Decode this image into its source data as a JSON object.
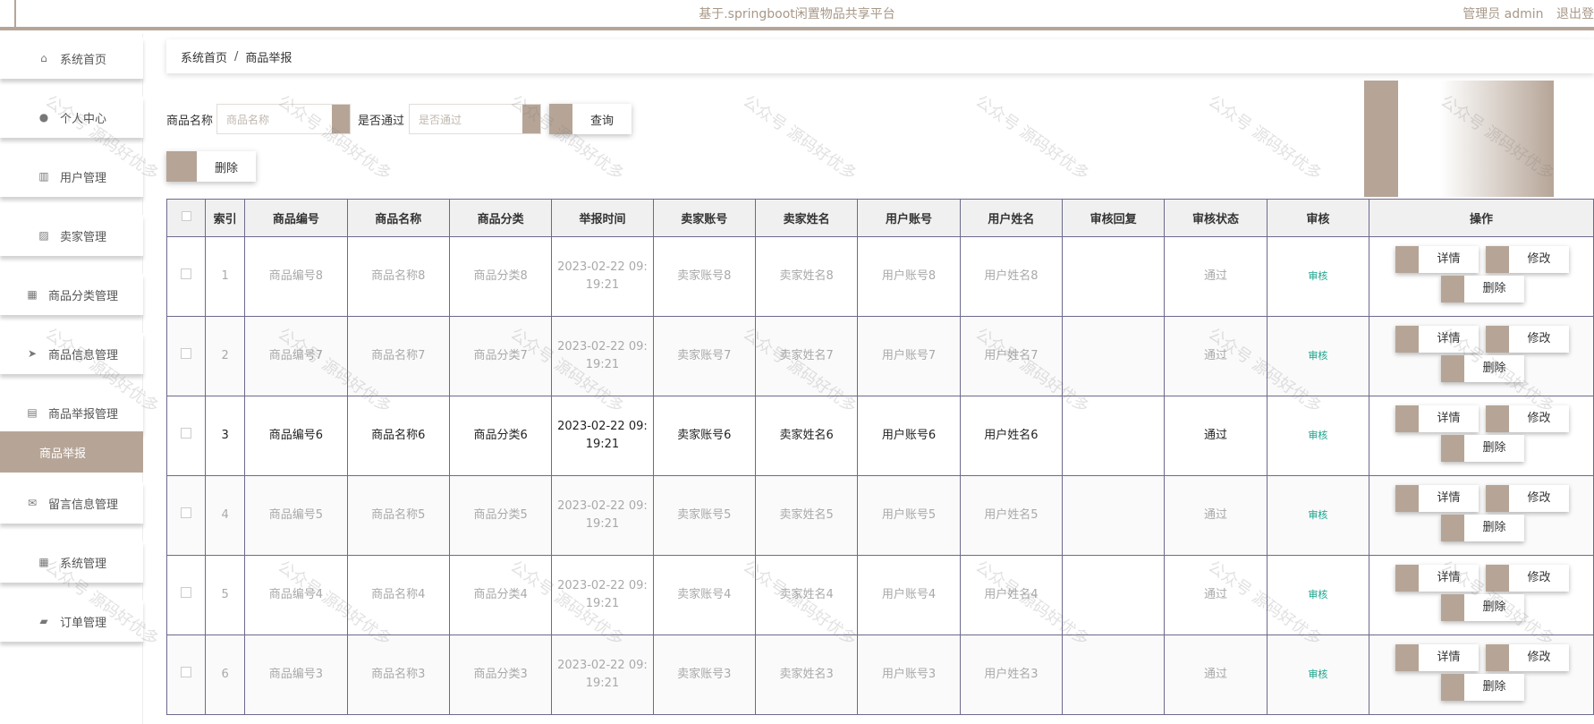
{
  "header": {
    "title": "基于.springboot闲置物品共享平台",
    "user_label": "管理员 admin",
    "logout": "退出登"
  },
  "sidebar": {
    "items": [
      {
        "label": "系统首页",
        "icon": "home-icon",
        "glyph": "⌂"
      },
      {
        "label": "个人中心",
        "icon": "user-icon",
        "glyph": "●"
      },
      {
        "label": "用户管理",
        "icon": "books-icon",
        "glyph": "▥"
      },
      {
        "label": "卖家管理",
        "icon": "chart-icon",
        "glyph": "▨"
      },
      {
        "label": "商品分类管理",
        "icon": "grid-icon",
        "glyph": "▦"
      },
      {
        "label": "商品信息管理",
        "icon": "send-icon",
        "glyph": "➤"
      },
      {
        "label": "商品举报管理",
        "icon": "clipboard-icon",
        "glyph": "▤"
      },
      {
        "label": "留言信息管理",
        "icon": "ticket-icon",
        "glyph": "✉"
      },
      {
        "label": "系统管理",
        "icon": "grid-icon",
        "glyph": "▦"
      },
      {
        "label": "订单管理",
        "icon": "folder-icon",
        "glyph": "▰"
      }
    ],
    "active_sub": "商品举报"
  },
  "breadcrumb": {
    "home": "系统首页",
    "sep": "/",
    "current": "商品举报"
  },
  "search": {
    "name_label": "商品名称",
    "name_placeholder": "商品名称",
    "pass_label": "是否通过",
    "pass_placeholder": "是否通过",
    "query": "查询",
    "delete": "删除"
  },
  "table": {
    "columns": [
      "",
      "索引",
      "商品编号",
      "商品名称",
      "商品分类",
      "举报时间",
      "卖家账号",
      "卖家姓名",
      "用户账号",
      "用户姓名",
      "审核回复",
      "审核状态",
      "审核",
      "操作"
    ],
    "rows": [
      {
        "index": "1",
        "code": "商品编号8",
        "name": "商品名称8",
        "category": "商品分类8",
        "time1": "2023-02-22 09:",
        "time2": "19:21",
        "seller_acct": "卖家账号8",
        "seller_name": "卖家姓名8",
        "user_acct": "用户账号8",
        "user_name": "用户姓名8",
        "reply": "",
        "status": "通过",
        "audit": "审核"
      },
      {
        "index": "2",
        "code": "商品编号7",
        "name": "商品名称7",
        "category": "商品分类7",
        "time1": "2023-02-22 09:",
        "time2": "19:21",
        "seller_acct": "卖家账号7",
        "seller_name": "卖家姓名7",
        "user_acct": "用户账号7",
        "user_name": "用户姓名7",
        "reply": "",
        "status": "通过",
        "audit": "审核"
      },
      {
        "index": "3",
        "code": "商品编号6",
        "name": "商品名称6",
        "category": "商品分类6",
        "time1": "2023-02-22 09:",
        "time2": "19:21",
        "seller_acct": "卖家账号6",
        "seller_name": "卖家姓名6",
        "user_acct": "用户账号6",
        "user_name": "用户姓名6",
        "reply": "",
        "status": "通过",
        "audit": "审核"
      },
      {
        "index": "4",
        "code": "商品编号5",
        "name": "商品名称5",
        "category": "商品分类5",
        "time1": "2023-02-22 09:",
        "time2": "19:21",
        "seller_acct": "卖家账号5",
        "seller_name": "卖家姓名5",
        "user_acct": "用户账号5",
        "user_name": "用户姓名5",
        "reply": "",
        "status": "通过",
        "audit": "审核"
      },
      {
        "index": "5",
        "code": "商品编号4",
        "name": "商品名称4",
        "category": "商品分类4",
        "time1": "2023-02-22 09:",
        "time2": "19:21",
        "seller_acct": "卖家账号4",
        "seller_name": "卖家姓名4",
        "user_acct": "用户账号4",
        "user_name": "用户姓名4",
        "reply": "",
        "status": "通过",
        "audit": "审核"
      },
      {
        "index": "6",
        "code": "商品编号3",
        "name": "商品名称3",
        "category": "商品分类3",
        "time1": "2023-02-22 09:",
        "time2": "19:21",
        "seller_acct": "卖家账号3",
        "seller_name": "卖家姓名3",
        "user_acct": "用户账号3",
        "user_name": "用户姓名3",
        "reply": "",
        "status": "通过",
        "audit": "审核"
      }
    ],
    "actions": {
      "detail": "详情",
      "edit": "修改",
      "delete": "删除"
    }
  },
  "watermark": "公众号 源码好优多",
  "colors": {
    "accent": "#b6a597",
    "audit": "#1aa38b"
  }
}
